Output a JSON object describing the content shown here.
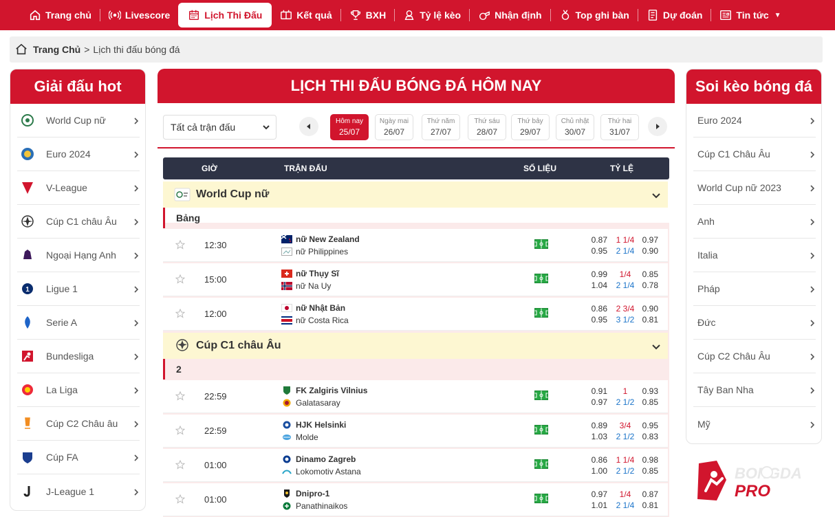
{
  "nav": {
    "items": [
      {
        "label": "Trang chủ",
        "icon": "home-icon"
      },
      {
        "label": "Livescore",
        "icon": "live-icon"
      },
      {
        "label": "Lịch Thi Đấu",
        "icon": "calendar-icon",
        "active": true
      },
      {
        "label": "Kết quả",
        "icon": "scoreboard-icon"
      },
      {
        "label": "BXH",
        "icon": "trophy-icon"
      },
      {
        "label": "Tỷ lệ kèo",
        "icon": "odds-icon"
      },
      {
        "label": "Nhận định",
        "icon": "whistle-icon"
      },
      {
        "label": "Top ghi bàn",
        "icon": "medal-icon"
      },
      {
        "label": "Dự đoán",
        "icon": "document-icon"
      },
      {
        "label": "Tin tức",
        "icon": "news-icon"
      }
    ]
  },
  "breadcrumb": {
    "home": "Trang Chủ",
    "separator": ">",
    "current": "Lịch thi đấu bóng đá"
  },
  "left_sidebar": {
    "title": "Giải đấu hot",
    "items": [
      "World Cup nữ",
      "Euro 2024",
      "V-League",
      "Cúp C1 châu Âu",
      "Ngoại Hạng Anh",
      "Ligue 1",
      "Serie A",
      "Bundesliga",
      "La Liga",
      "Cúp C2 Châu âu",
      "Cúp FA",
      "J-League 1"
    ]
  },
  "right_sidebar": {
    "title": "Soi kèo bóng đá",
    "items": [
      "Euro 2024",
      "Cúp C1 Châu Âu",
      "World Cup nữ 2023",
      "Anh",
      "Italia",
      "Pháp",
      "Đức",
      "Cúp C2 Châu Âu",
      "Tây Ban Nha",
      "Mỹ"
    ]
  },
  "main": {
    "title": "LỊCH THI ĐẤU BÓNG ĐÁ HÔM NAY",
    "filter": "Tất cả trận đấu",
    "dates": [
      {
        "day": "Hôm nay",
        "date": "25/07"
      },
      {
        "day": "Ngày mai",
        "date": "26/07"
      },
      {
        "day": "Thứ năm",
        "date": "27/07"
      },
      {
        "day": "Thứ sáu",
        "date": "28/07"
      },
      {
        "day": "Thứ bảy",
        "date": "29/07"
      },
      {
        "day": "Chủ nhật",
        "date": "30/07"
      },
      {
        "day": "Thứ hai",
        "date": "31/07"
      }
    ],
    "columns": {
      "time": "GIỜ",
      "match": "TRẬN ĐẤU",
      "stats": "SỐ LIỆU",
      "odds": "TỶ LỆ"
    },
    "leagues": [
      {
        "name": "World Cup nữ",
        "round": "Bảng",
        "matches": [
          {
            "time": "12:30",
            "home": "nữ New Zealand",
            "away": "nữ Philippines",
            "o": [
              [
                "0.87",
                "1 1/4",
                "0.97"
              ],
              [
                "0.95",
                "2 1/4",
                "0.90"
              ]
            ]
          },
          {
            "time": "15:00",
            "home": "nữ Thụy Sĩ",
            "away": "nữ Na Uy",
            "o": [
              [
                "0.99",
                "1/4",
                "0.85"
              ],
              [
                "1.04",
                "2 1/4",
                "0.78"
              ]
            ]
          },
          {
            "time": "12:00",
            "home": "nữ Nhật Bản",
            "away": "nữ Costa Rica",
            "o": [
              [
                "0.86",
                "2 3/4",
                "0.90"
              ],
              [
                "0.95",
                "3 1/2",
                "0.81"
              ]
            ]
          }
        ]
      },
      {
        "name": "Cúp C1 châu Âu",
        "round": "2",
        "matches": [
          {
            "time": "22:59",
            "home": "FK Zalgiris Vilnius",
            "away": "Galatasaray",
            "o": [
              [
                "0.91",
                "1",
                "0.93"
              ],
              [
                "0.97",
                "2 1/2",
                "0.85"
              ]
            ]
          },
          {
            "time": "22:59",
            "home": "HJK Helsinki",
            "away": "Molde",
            "o": [
              [
                "0.89",
                "3/4",
                "0.95"
              ],
              [
                "1.03",
                "2 1/2",
                "0.83"
              ]
            ]
          },
          {
            "time": "01:00",
            "home": "Dinamo Zagreb",
            "away": "Lokomotiv Astana",
            "o": [
              [
                "0.86",
                "1 1/4",
                "0.98"
              ],
              [
                "1.00",
                "2 1/2",
                "0.85"
              ]
            ]
          },
          {
            "time": "01:00",
            "home": "Dnipro-1",
            "away": "Panathinaikos",
            "o": [
              [
                "0.97",
                "1/4",
                "0.87"
              ],
              [
                "1.01",
                "2 1/4",
                "0.81"
              ]
            ]
          }
        ]
      }
    ]
  },
  "brand": {
    "name_top": "BONGDA",
    "name_bottom": "PRO"
  },
  "colors": {
    "primary": "#d1152d",
    "header_dark": "#2e3345",
    "league_bg": "#fdf7d2",
    "odds_blue": "#1b74c9"
  }
}
